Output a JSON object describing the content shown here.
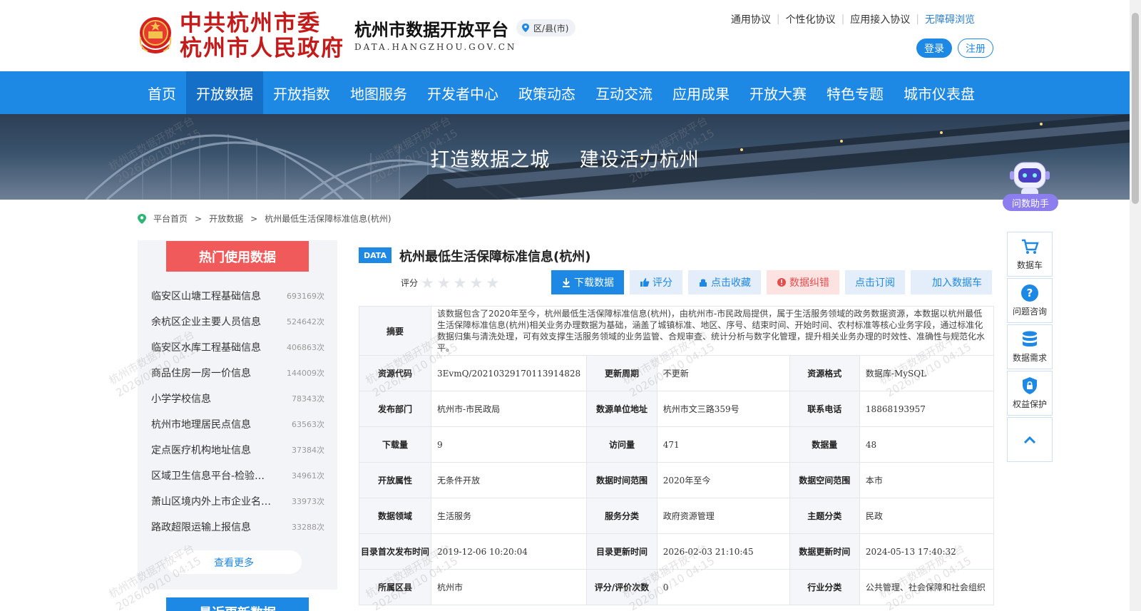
{
  "header": {
    "gov_name_line1": "中共杭州市委",
    "gov_name_line2": "杭州市人民政府",
    "platform_name": "杭州市数据开放平台",
    "domain": "DATA.HANGZHOU.GOV.CN",
    "region_selector": "区/县(市)",
    "top_links": [
      "通用协议",
      "个性化协议",
      "应用接入协议",
      "无障碍浏览"
    ],
    "login_label": "登录",
    "register_label": "注册"
  },
  "nav": {
    "items": [
      "首页",
      "开放数据",
      "开放指数",
      "地图服务",
      "开发者中心",
      "政策动态",
      "互动交流",
      "应用成果",
      "开放大赛",
      "特色专题",
      "城市仪表盘"
    ],
    "active": "开放数据"
  },
  "banner": {
    "slogan_left": "打造数据之城",
    "slogan_right": "建设活力杭州"
  },
  "breadcrumb": [
    "平台首页",
    "开放数据",
    "杭州最低生活保障标准信息(杭州)"
  ],
  "hot_panel": {
    "title": "热门使用数据",
    "items": [
      {
        "name": "临安区山塘工程基础信息",
        "count": "693169次"
      },
      {
        "name": "余杭区企业主要人员信息",
        "count": "524642次"
      },
      {
        "name": "临安区水库工程基础信息",
        "count": "406863次"
      },
      {
        "name": "商品住房一房一价信息",
        "count": "144009次"
      },
      {
        "name": "小学学校信息",
        "count": "78343次"
      },
      {
        "name": "杭州市地理居民点信息",
        "count": "63563次"
      },
      {
        "name": "定点医疗机构地址信息",
        "count": "37384次"
      },
      {
        "name": "区域卫生信息平台-检验…",
        "count": "34961次"
      },
      {
        "name": "萧山区境内外上市企业名…",
        "count": "33973次"
      },
      {
        "name": "路政超限运输上报信息",
        "count": "33288次"
      }
    ],
    "more_label": "查看更多",
    "recent_title": "最近更新数据"
  },
  "dataset": {
    "badge": "DATA",
    "title": "杭州最低生活保障标准信息(杭州)",
    "rating_label": "评分",
    "rating_stars": 0,
    "actions": [
      "下载数据",
      "评分",
      "点击收藏",
      "数据纠错",
      "点击订阅",
      "加入数据车"
    ],
    "summary_label": "摘要",
    "summary": "该数据包含了2020年至今，杭州最低生活保障标准信息(杭州)，由杭州市-市民政局提供，属于生活服务领域的政务数据资源，本数据以杭州最低生活保障标准信息(杭州)相关业务办理数据为基础，涵盖了城镇标准、地区、序号、结束时间、开始时间、农村标准等核心业务字段，通过标准化数据归集与清洗处理，可有效支撑生活服务领域的业务监管、合规审查、统计分析与数字化管理，提升相关业务办理的时效性、准确性与规范化水平。",
    "rows": [
      [
        {
          "k": "资源代码",
          "v": "3EvmQ/20210329170113914828"
        },
        {
          "k": "更新周期",
          "v": "不更新"
        },
        {
          "k": "资源格式",
          "v": "数据库-MySQL"
        }
      ],
      [
        {
          "k": "发布部门",
          "v": "杭州市-市民政局"
        },
        {
          "k": "数源单位地址",
          "v": "杭州市文三路359号"
        },
        {
          "k": "联系电话",
          "v": "18868193957"
        }
      ],
      [
        {
          "k": "下载量",
          "v": "9"
        },
        {
          "k": "访问量",
          "v": "471"
        },
        {
          "k": "数据量",
          "v": "48"
        }
      ],
      [
        {
          "k": "开放属性",
          "v": "无条件开放"
        },
        {
          "k": "数据时间范围",
          "v": "2020年至今"
        },
        {
          "k": "数据空间范围",
          "v": "本市"
        }
      ],
      [
        {
          "k": "数据领域",
          "v": "生活服务"
        },
        {
          "k": "服务分类",
          "v": "政府资源管理"
        },
        {
          "k": "主题分类",
          "v": "民政"
        }
      ],
      [
        {
          "k": "目录首次发布时间",
          "v": "2019-12-06 10:20:04"
        },
        {
          "k": "目录更新时间",
          "v": "2026-02-03 21:10:45"
        },
        {
          "k": "数据更新时间",
          "v": "2024-05-13 17:40:32"
        }
      ],
      [
        {
          "k": "所属区县",
          "v": "杭州市"
        },
        {
          "k": "评分/评价次数",
          "v": "0"
        },
        {
          "k": "行业分类",
          "v": "公共管理、社会保障和社会组织"
        }
      ]
    ]
  },
  "side_tools": {
    "assistant_label": "问数助手",
    "items": [
      {
        "label": "数据车",
        "icon": "cart-icon"
      },
      {
        "label": "问题咨询",
        "icon": "question-icon"
      },
      {
        "label": "数据需求",
        "icon": "database-icon"
      },
      {
        "label": "权益保护",
        "icon": "shield-icon"
      }
    ]
  },
  "watermark": {
    "line1": "杭州市数据开放平台",
    "line2": "2026/09/10 04:15"
  },
  "colors": {
    "primary": "#1e88e5",
    "hot_red": "#f15a5a",
    "gov_red": "#c41a1a"
  }
}
